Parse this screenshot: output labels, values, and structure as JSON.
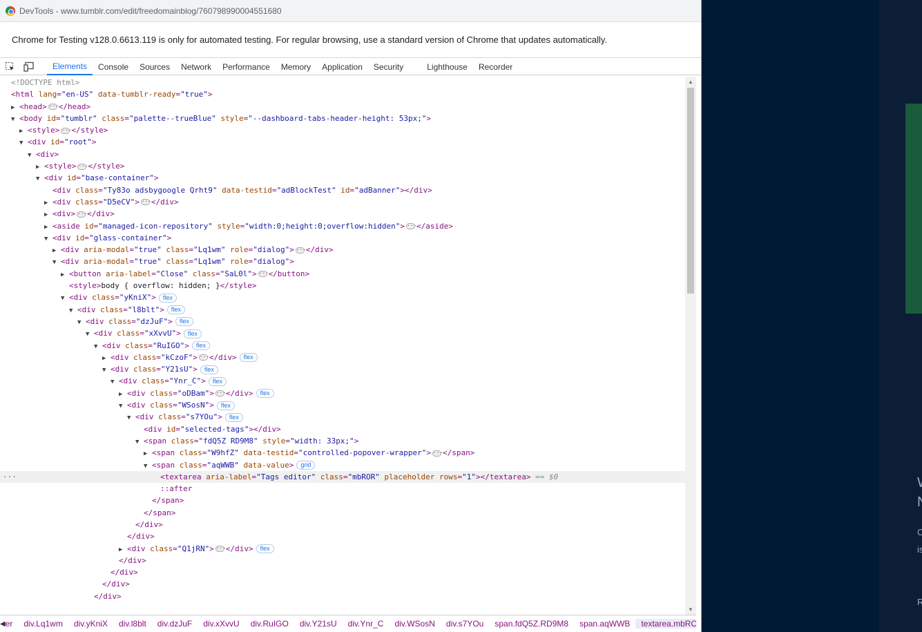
{
  "window_title": "DevTools - www.tumblr.com/edit/freedomainblog/760798990004551680",
  "infobar_text": "Chrome for Testing v128.0.6613.119 is only for automated testing. For regular browsing, use a standard version of Chrome that updates automatically.",
  "tabs": [
    "Elements",
    "Console",
    "Sources",
    "Network",
    "Performance",
    "Memory",
    "Application",
    "Security",
    "Lighthouse",
    "Recorder"
  ],
  "active_tab": "Elements",
  "dom_lines": [
    "<!DOCTYPE html>",
    "<html lang=\"en-US\" data-tumblr-ready=\"true\">",
    "<head> … </head>",
    "<body id=\"tumblr\" class=\"palette--trueBlue\" style=\"--dashboard-tabs-header-height: 53px;\">",
    "<style> … </style>",
    "<div id=\"root\">",
    "<div>",
    "<style> … </style>",
    "<div id=\"base-container\">",
    "<div class=\"Ty83o adsbygoogle Qrht9\" data-testid=\"adBlockTest\" id=\"adBanner\"></div>",
    "<div class=\"D5eCV\"> … </div>",
    "<div> … </div>",
    "<aside id=\"managed-icon-repository\" style=\"width:0;height:0;overflow:hidden\"> … </aside>",
    "<div id=\"glass-container\">",
    "<div aria-modal=\"true\" class=\"Lq1wm\" role=\"dialog\"> … </div>",
    "<div aria-modal=\"true\" class=\"Lq1wm\" role=\"dialog\">",
    "<button aria-label=\"Close\" class=\"SaL0l\"> … </button>",
    "<style>body { overflow: hidden; }</style>",
    "<div class=\"yKniX\">",
    "<div class=\"l8blt\">",
    "<div class=\"dzJuF\">",
    "<div class=\"xXvvU\">",
    "<div class=\"RuIGO\">",
    "<div class=\"kCzoF\"> … </div>",
    "<div class=\"Y21sU\">",
    "<div class=\"Ynr_C\">",
    "<div class=\"oDBam\"> … </div>",
    "<div class=\"WSosN\">",
    "<div class=\"s7YOu\">",
    "<div id=\"selected-tags\"></div>",
    "<span class=\"fdQ5Z RD9M8\" style=\"width: 33px;\">",
    "<span class=\"W9hfZ\" data-testid=\"controlled-popover-wrapper\"> … </span>",
    "<span class=\"aqWWB\" data-value>",
    "<textarea aria-label=\"Tags editor\" class=\"mbROR\" placeholder rows=\"1\"></textarea>",
    "::after",
    "</span>",
    "</span>",
    "</div>",
    "</div>",
    "<div class=\"Q1jRN\"> … </div>",
    "</div>",
    "</div>",
    "</div>",
    "</div>"
  ],
  "badge_flex": "flex",
  "badge_grid": "grid",
  "selected_marker": "== $0",
  "row_dots": "···",
  "breadcrumbs": [
    "er",
    "div.Lq1wm",
    "div.yKniX",
    "div.l8blt",
    "div.dzJuF",
    "div.xXvvU",
    "div.RuIGO",
    "div.Y21sU",
    "div.Ynr_C",
    "div.WSosN",
    "div.s7YOu",
    "span.fdQ5Z.RD9M8",
    "span.aqWWB",
    "textarea.mbROR"
  ],
  "active_breadcrumb": "textarea.mbROR",
  "background_fragments": [
    "W",
    "N",
    "C",
    "is",
    "R"
  ]
}
